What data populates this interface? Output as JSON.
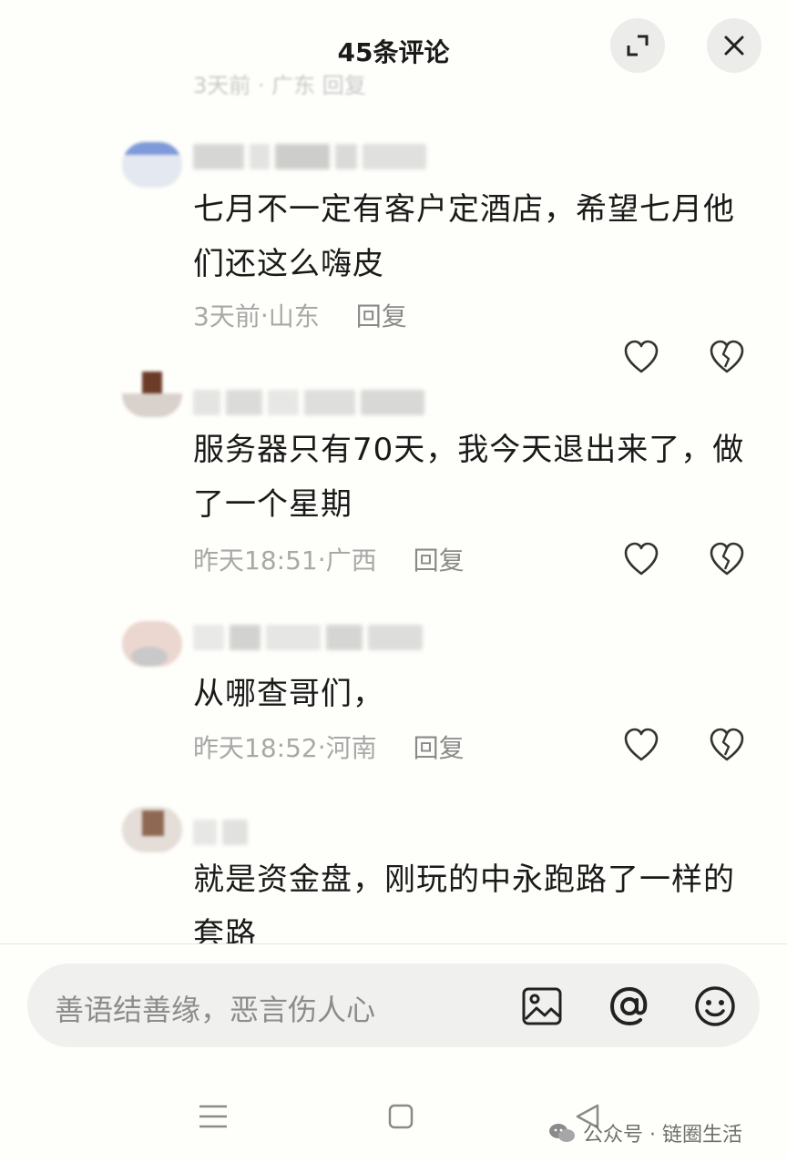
{
  "header": {
    "title": "45条评论"
  },
  "ghost_row": "3天前 · 广东    回复",
  "comments": [
    {
      "content": "七月不一定有客户定酒店，希望七月他们还这么嗨皮",
      "time": "3天前",
      "location": "山东",
      "reply": "回复"
    },
    {
      "content": "服务器只有70天，我今天退出来了，做了一个星期",
      "time": "昨天18:51",
      "location": "广西",
      "reply": "回复"
    },
    {
      "content": "从哪查哥们，",
      "time": "昨天18:52",
      "location": "河南",
      "reply": "回复"
    },
    {
      "content": "就是资金盘，刚玩的中永跑路了一样的套路"
    }
  ],
  "meta_separator": " · ",
  "input": {
    "placeholder": "善语结善缘，恶言伤人心"
  },
  "watermark": {
    "text": "公众号 · 链圈生活"
  },
  "icons": [
    "expand-icon",
    "close-icon",
    "heart-icon",
    "broken-heart-icon",
    "image-icon",
    "at-icon",
    "emoji-icon",
    "menu-icon",
    "home-icon",
    "back-icon",
    "wechat-icon"
  ],
  "colors": {
    "text": "#1a1a1a",
    "meta": "#a8a8a8",
    "background": "#fefefa",
    "input_bg": "#f0f0ee"
  }
}
